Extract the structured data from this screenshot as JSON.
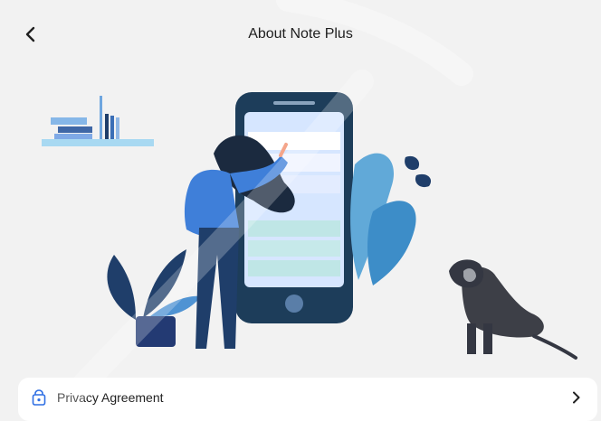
{
  "header": {
    "title": "About Note Plus",
    "back_icon": "chevron-left-icon"
  },
  "menu": {
    "items": [
      {
        "label": "Privacy Agreement",
        "icon": "lock-bag-icon"
      }
    ]
  },
  "colors": {
    "background": "#f2f2f2",
    "card": "#ffffff",
    "accent_dark": "#1a3c58",
    "accent_blue": "#4a90e2",
    "accent_light": "#d9e8ff"
  }
}
